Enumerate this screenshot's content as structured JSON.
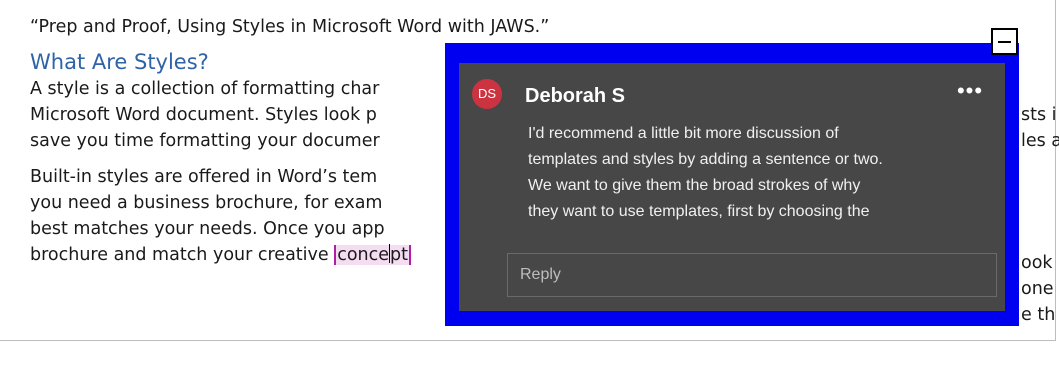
{
  "document": {
    "title_line": "“Prep and Proof, Using Styles in Microsoft Word with JAWS.”",
    "heading": "What Are Styles?",
    "paragraph1": [
      "A style is a collection of formatting char",
      "Microsoft Word document. Styles look p",
      "save you time formatting your documer"
    ],
    "paragraph1_right": [
      "sts i",
      "les a",
      ""
    ],
    "paragraph2": [
      "Built-in styles are offered in Word’s tem",
      "you need a business brochure, for exam",
      "best matches your needs. Once you app",
      "brochure and match your creative "
    ],
    "paragraph2_right": [
      "ook",
      "one",
      "e th",
      ""
    ],
    "highlighted_word_before_caret": "conce",
    "highlighted_word_after_caret": "pt"
  },
  "comment": {
    "avatar_initials": "DS",
    "author": "Deborah S",
    "more_glyph": "•••",
    "body_lines": [
      "I'd recommend a little bit more discussion of",
      "templates and styles by adding a sentence or two.",
      "We want to give them the broad strokes of why",
      "they want to use templates, first by choosing the"
    ],
    "reply_placeholder": "Reply",
    "collapse_glyph": "—"
  },
  "colors": {
    "focus_border": "#0000f0",
    "card_background": "#474747",
    "avatar": "#cc3340",
    "heading": "#2e63a8",
    "highlight": "#f4dcf1"
  }
}
